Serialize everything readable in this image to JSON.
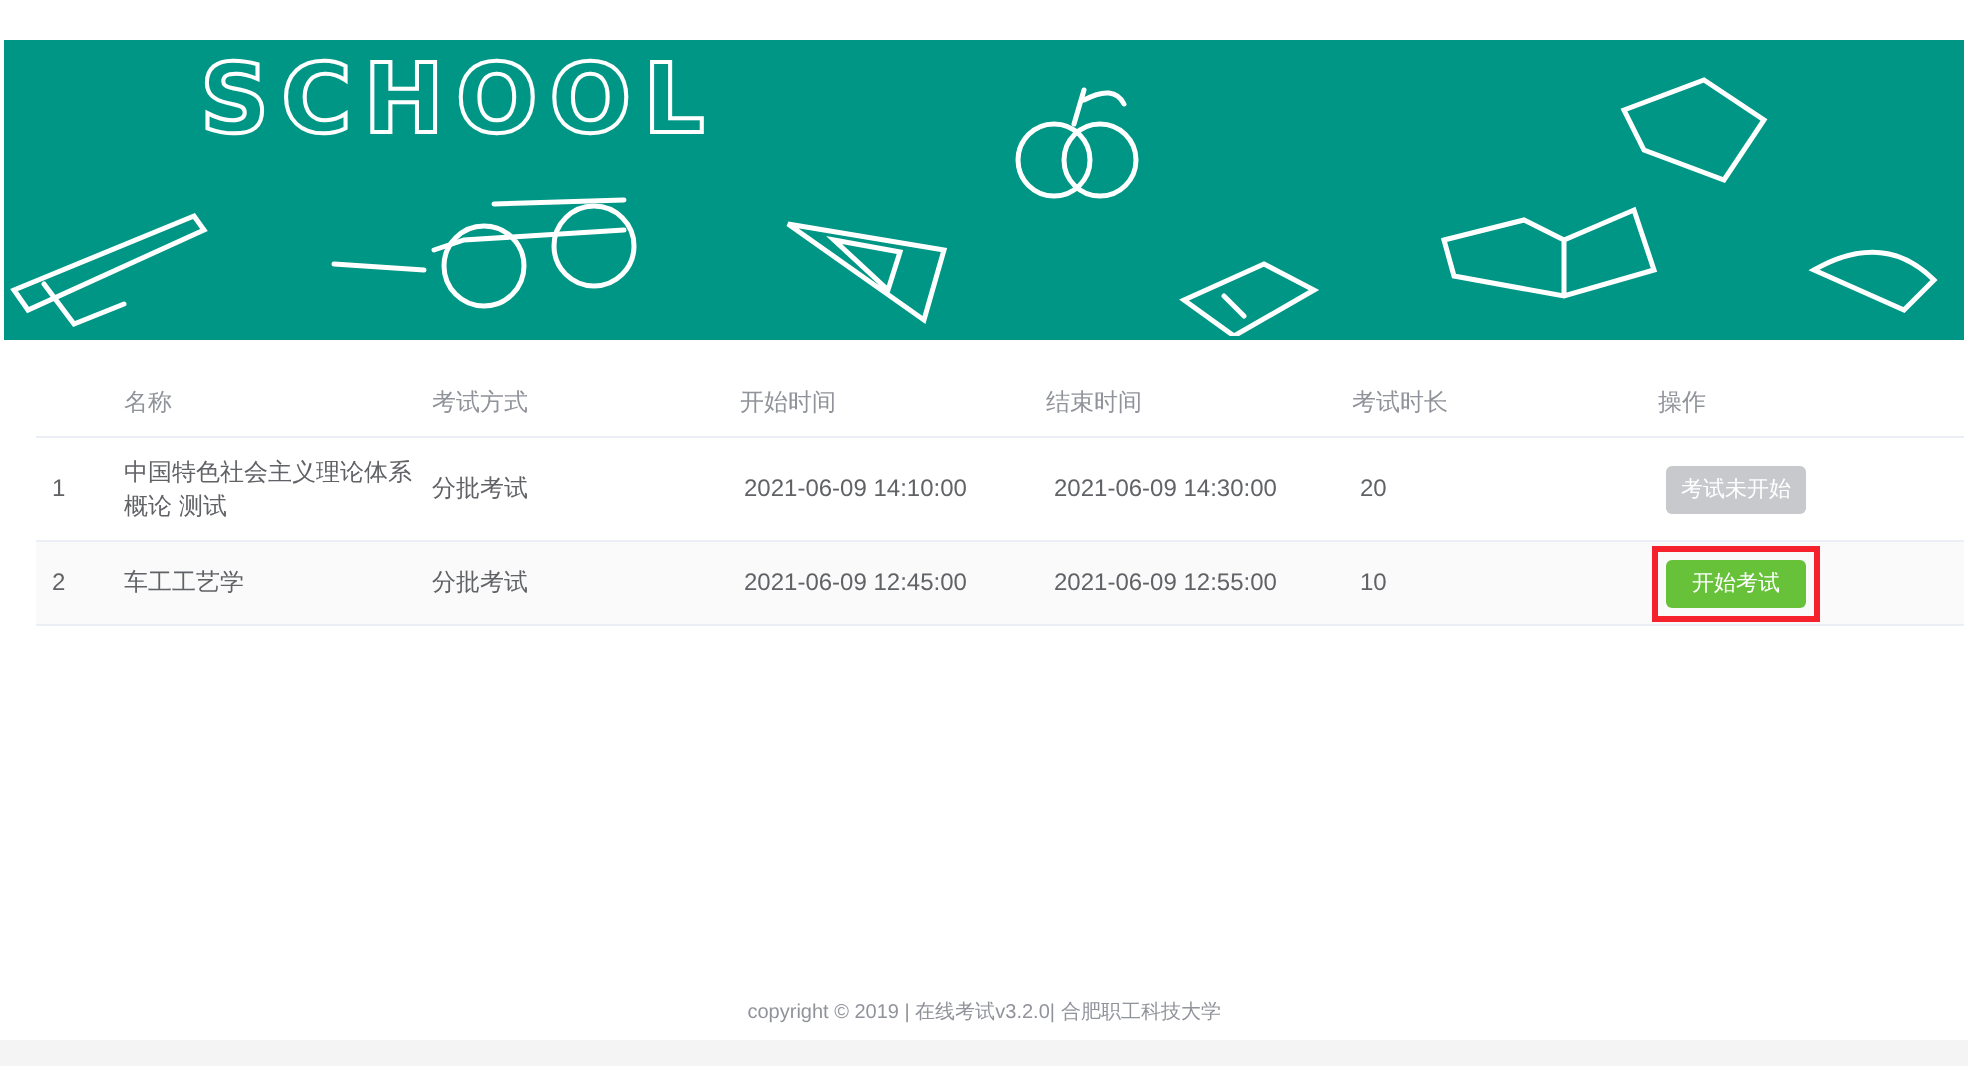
{
  "banner": {
    "title": "SCHOOL"
  },
  "table": {
    "columns": [
      "名称",
      "考试方式",
      "开始时间",
      "结束时间",
      "考试时长",
      "操作"
    ],
    "rows": [
      {
        "index": "1",
        "name": "中国特色社会主义理论体系概论 测试",
        "method": "分批考试",
        "start": "2021-06-09 14:10:00",
        "end": "2021-06-09 14:30:00",
        "duration": "20",
        "action": {
          "label": "考试未开始",
          "disabled": true,
          "highlighted": false
        }
      },
      {
        "index": "2",
        "name": "车工工艺学",
        "method": "分批考试",
        "start": "2021-06-09 12:45:00",
        "end": "2021-06-09 12:55:00",
        "duration": "10",
        "action": {
          "label": "开始考试",
          "disabled": false,
          "highlighted": true
        }
      }
    ]
  },
  "footer": {
    "text": "copyright © 2019 | 在线考试v3.2.0| 合肥职工科技大学"
  }
}
